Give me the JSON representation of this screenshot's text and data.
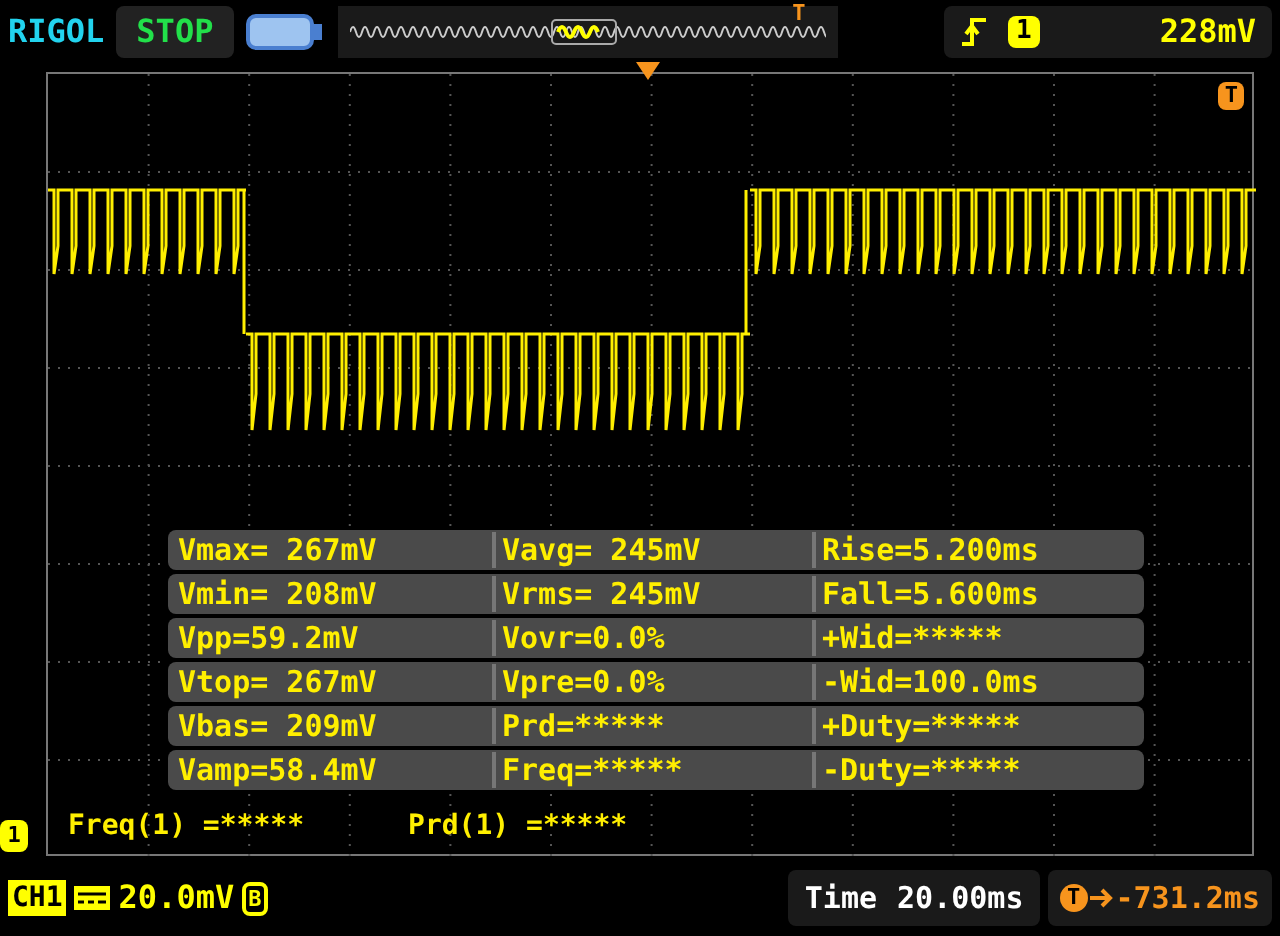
{
  "brand": "RIGOL",
  "run_state": "STOP",
  "overview": {
    "trigger_mark": "T"
  },
  "trigger": {
    "channel": "1",
    "level": "228mV"
  },
  "screen": {
    "trigger_level_mark": "T",
    "channel_mark": "1"
  },
  "measurements": [
    [
      "Vmax= 267mV",
      "Vavg= 245mV",
      "Rise=5.200ms"
    ],
    [
      "Vmin= 208mV",
      "Vrms= 245mV",
      "Fall=5.600ms"
    ],
    [
      "Vpp=59.2mV",
      "Vovr=0.0%",
      "+Wid=*****"
    ],
    [
      "Vtop= 267mV",
      "Vpre=0.0%",
      "-Wid=100.0ms"
    ],
    [
      "Vbas= 209mV",
      "Prd=*****",
      "+Duty=*****"
    ],
    [
      "Vamp=58.4mV",
      "Freq=*****",
      "-Duty=*****"
    ]
  ],
  "footer_measurements": [
    "Freq(1) =*****",
    "Prd(1) =*****"
  ],
  "status": {
    "channel": "CH1",
    "scale": "20.0mV",
    "bandwidth": "B",
    "time_label": "Time",
    "timebase": "20.00ms",
    "trigger_mark": "T",
    "trigger_offset": "-731.2ms"
  }
}
